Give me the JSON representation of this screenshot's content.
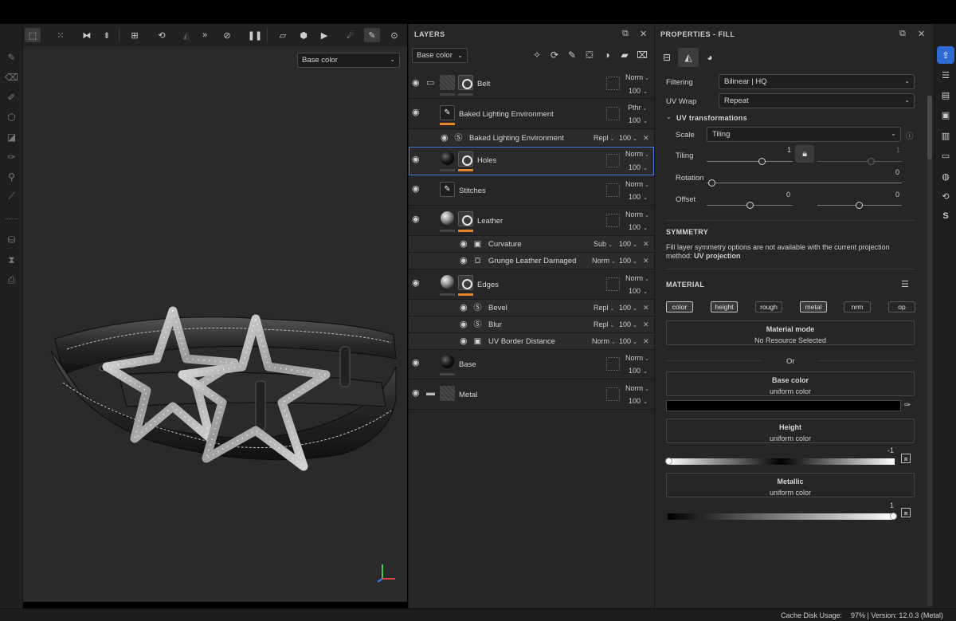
{
  "viewport": {
    "channel_select": "Base color",
    "toolbar_icons": [
      "select-icon",
      "grid-icon",
      "mirror-x-icon",
      "mirror-y-icon",
      "frame-icon",
      "history-icon",
      "symmetry-icon",
      "more-icon",
      "stencil-icon",
      "pause-icon",
      "camera-view-icon",
      "cube-icon",
      "video-icon",
      "light-icon",
      "paint-brush-icon",
      "screenshot-icon"
    ],
    "axis_gizmo": "xyz-axis-gizmo"
  },
  "layers_panel": {
    "title": "LAYERS",
    "channel_select": "Base color",
    "toolbar_icons": [
      "magic-wand-icon",
      "smart-material-icon",
      "brush-icon",
      "fill-icon",
      "mask-icon",
      "folder-icon",
      "trash-icon"
    ],
    "layers": [
      {
        "name": "Belt",
        "blend": "Norm",
        "opacity": "100",
        "type": "folder"
      },
      {
        "name": "Baked Lighting Environment",
        "blend": "Pthr",
        "opacity": "100",
        "type": "paint"
      },
      {
        "name": "Baked Lighting Environment",
        "blend": "Repl",
        "opacity": "100",
        "type": "sub"
      },
      {
        "name": "Holes",
        "blend": "Norm",
        "opacity": "100",
        "type": "fill"
      },
      {
        "name": "Stitches",
        "blend": "Norm",
        "opacity": "100",
        "type": "paint"
      },
      {
        "name": "Leather",
        "blend": "Norm",
        "opacity": "100",
        "type": "fill"
      },
      {
        "name": "Curvature",
        "blend": "Sub",
        "opacity": "100",
        "type": "sub"
      },
      {
        "name": "Grunge Leather Damaged",
        "blend": "Norm",
        "opacity": "100",
        "type": "sub"
      },
      {
        "name": "Edges",
        "blend": "Norm",
        "opacity": "100",
        "type": "fill"
      },
      {
        "name": "Bevel",
        "blend": "Repl",
        "opacity": "100",
        "type": "sub"
      },
      {
        "name": "Blur",
        "blend": "Repl",
        "opacity": "100",
        "type": "sub"
      },
      {
        "name": "UV Border Distance",
        "blend": "Norm",
        "opacity": "100",
        "type": "sub"
      },
      {
        "name": "Base",
        "blend": "Norm",
        "opacity": "100",
        "type": "fill"
      },
      {
        "name": "Metal",
        "blend": "Norm",
        "opacity": "100",
        "type": "folder"
      }
    ]
  },
  "properties": {
    "title": "PROPERTIES - FILL",
    "filtering_label": "Filtering",
    "filtering_value": "Bilinear | HQ",
    "uvwrap_label": "UV Wrap",
    "uvwrap_value": "Repeat",
    "uv_transform_title": "UV transformations",
    "scale_label": "Scale",
    "scale_value": "Tiling",
    "tiling_label": "Tiling",
    "tiling_value": "1",
    "tiling_value_locked": "1",
    "rotation_label": "Rotation",
    "rotation_value": "0",
    "offset_label": "Offset",
    "offset_x": "0",
    "offset_y": "0",
    "symmetry_title": "SYMMETRY",
    "symmetry_text": "Fill layer symmetry options are not available with the current projection method:",
    "symmetry_method": "UV projection",
    "material_title": "MATERIAL",
    "channels": [
      {
        "label": "color",
        "on": true
      },
      {
        "label": "height",
        "on": true
      },
      {
        "label": "rough",
        "on": false
      },
      {
        "label": "metal",
        "on": true
      },
      {
        "label": "nrm",
        "on": false
      },
      {
        "label": "op",
        "on": false
      }
    ],
    "material_mode_title": "Material mode",
    "material_mode_value": "No Resource Selected",
    "or_label": "Or",
    "base_color_title": "Base color",
    "base_color_value": "uniform color",
    "base_color_swatch": "#000000",
    "height_title": "Height",
    "height_value": "uniform color",
    "height_level": "-1",
    "metallic_title": "Metallic",
    "metallic_value": "uniform color",
    "metallic_level": "1"
  },
  "status": {
    "cache_label": "Cache Disk Usage:",
    "cache_value": "97% | Version: 12.0.3 (Metal)"
  },
  "colors": {
    "accent": "#2e6bd2",
    "orange": "#e3862a",
    "panel": "#262626"
  }
}
